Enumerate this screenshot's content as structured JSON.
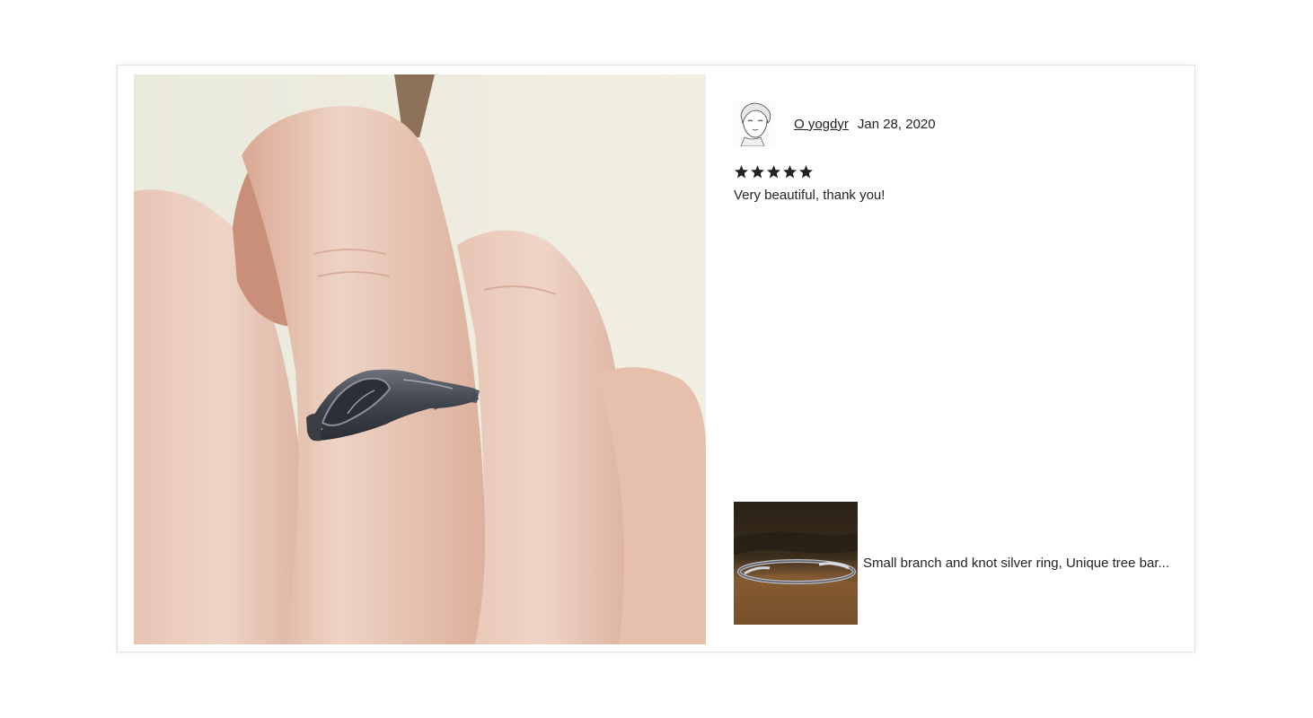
{
  "review": {
    "reviewer_name": "O yogdyr",
    "date": "Jan 28, 2020",
    "rating": 5,
    "rating_max": 5,
    "text": "Very beautiful, thank you!"
  },
  "product": {
    "title": "Small branch and knot silver ring, Unique tree bar..."
  },
  "icons": {
    "star": "star-icon"
  },
  "colors": {
    "star": "#222222",
    "ring": "#4a4e57",
    "skin": "#eacdbd",
    "background": "#ffffff"
  }
}
